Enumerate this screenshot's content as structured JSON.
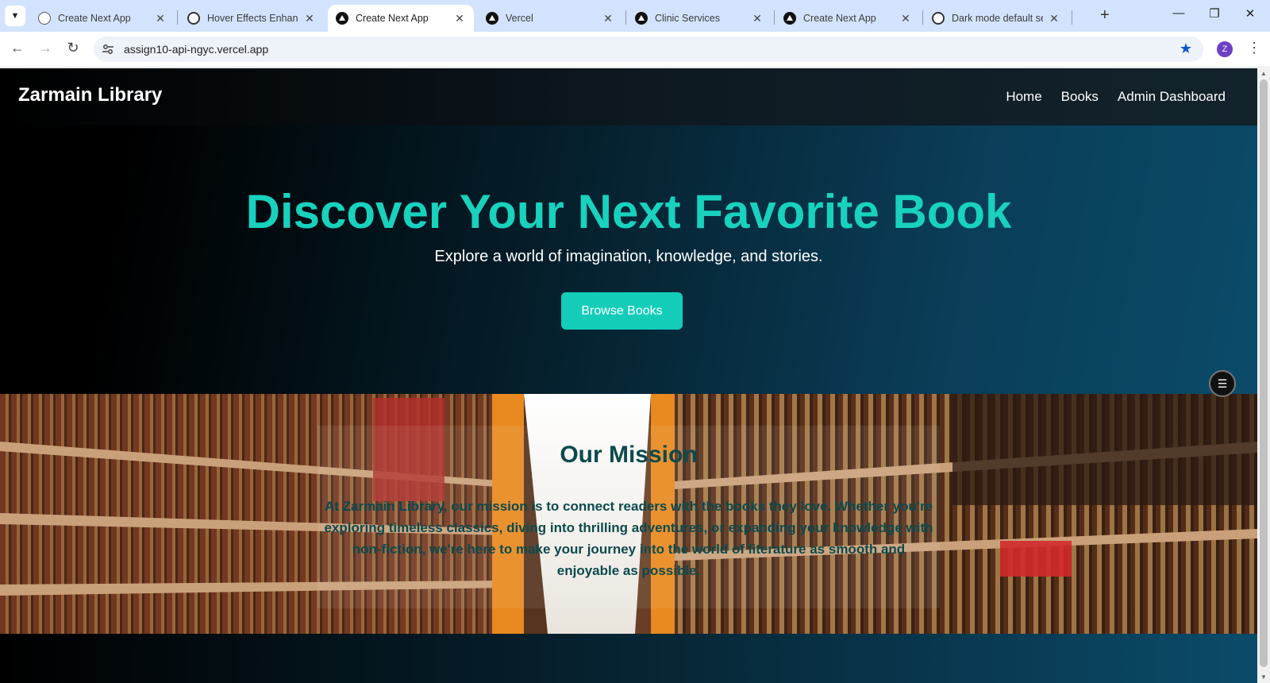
{
  "browser": {
    "tabs": [
      {
        "title": "Create Next App",
        "icon": "globe-icon",
        "active": false
      },
      {
        "title": "Hover Effects Enhance",
        "icon": "openai-icon",
        "active": false
      },
      {
        "title": "Create Next App",
        "icon": "vercel-icon",
        "active": true
      },
      {
        "title": "Vercel",
        "icon": "vercel-icon",
        "active": false
      },
      {
        "title": "Clinic Services",
        "icon": "vercel-icon",
        "active": false
      },
      {
        "title": "Create Next App",
        "icon": "vercel-icon",
        "active": false
      },
      {
        "title": "Dark mode default set",
        "icon": "openai-icon",
        "active": false
      }
    ],
    "url": "assign10-api-ngyc.vercel.app",
    "profile_initial": "Z"
  },
  "site": {
    "brand": "Zarmain Library",
    "nav": [
      "Home",
      "Books",
      "Admin Dashboard"
    ]
  },
  "hero": {
    "title": "Discover Your Next Favorite Book",
    "subtitle": "Explore a world of imagination, knowledge, and stories.",
    "cta": "Browse Books"
  },
  "mission": {
    "heading": "Our Mission",
    "body": "At Zarmain Library, our mission is to connect readers with the books they love. Whether you're exploring timeless classics, diving into thrilling adventures, or expanding your knowledge with non-fiction, we're here to make your journey into the world of literature as smooth and enjoyable as possible."
  },
  "colors": {
    "accent": "#18d2bd",
    "mission_text": "#0b4a4e",
    "tabbar": "#d3e3fd"
  }
}
